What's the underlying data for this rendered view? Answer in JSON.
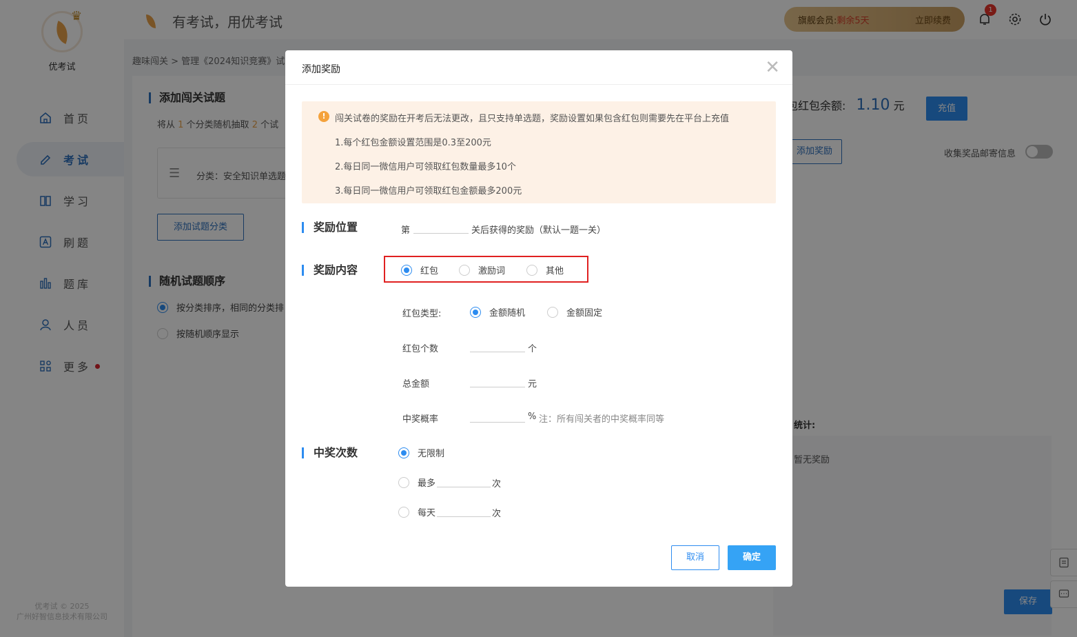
{
  "sidebar": {
    "logo_text": "优考试",
    "items": [
      {
        "label": "首页",
        "icon": "home-icon"
      },
      {
        "label": "考试",
        "icon": "pen-icon"
      },
      {
        "label": "学习",
        "icon": "book-icon"
      },
      {
        "label": "刷题",
        "icon": "letter-a-icon"
      },
      {
        "label": "题库",
        "icon": "bars-icon"
      },
      {
        "label": "人员",
        "icon": "user-icon"
      },
      {
        "label": "更多",
        "icon": "grid-icon"
      }
    ],
    "copyright_line1": "优考试 © 2025",
    "copyright_line2": "广州好智信息技术有限公司"
  },
  "header": {
    "slogan": "有考试，用优考试",
    "vip_label": "旗舰会员: ",
    "vip_days": "剩余5天",
    "vip_renew": "立即续费",
    "notification_count": "1"
  },
  "page": {
    "breadcrumb": "趣味闯关 > 管理《2024知识竞赛》试",
    "section1_title": "添加闯关试题",
    "section1_desc_pre": "将从 ",
    "section1_desc_n1": "1",
    "section1_desc_mid": " 个分类随机抽取 ",
    "section1_desc_n2": "2",
    "section1_desc_post": " 个试",
    "category_text": "分类：安全知识单选题",
    "add_category_button": "添加试题分类",
    "section2_title": "随机试题顺序",
    "order_option1": "按分类排序，相同的分类排",
    "order_option2": "按随机顺序显示",
    "balance_label": "包红包余额:",
    "balance_value": "1.10",
    "balance_unit": "元",
    "recharge_button": "充值",
    "add_reward_button": "添加奖励",
    "collect_label": "收集奖品邮寄信息",
    "stats_label": "统计:",
    "no_reward": "暂无奖励",
    "save_button": "保存"
  },
  "modal": {
    "title": "添加奖励",
    "notice": {
      "line1": "闯关试卷的奖励在开考后无法更改，且只支持单选题，奖励设置如果包含红包则需要先在平台上充值",
      "line2": "1.每个红包金额设置范围是0.3至200元",
      "line3": "2.每日同一微信用户可领取红包数量最多10个",
      "line4": "3.每日同一微信用户可领取红包金额最多200元"
    },
    "position": {
      "title": "奖励位置",
      "prefix": "第",
      "suffix": "关后获得的奖励（默认一题一关）",
      "value": ""
    },
    "content": {
      "title": "奖励内容",
      "options": [
        "红包",
        "激励词",
        "其他"
      ],
      "selected": "红包"
    },
    "redpacket": {
      "type_label": "红包类型:",
      "type_options": [
        "金额随机",
        "金额固定"
      ],
      "type_selected": "金额随机",
      "count_label": "红包个数",
      "count_unit": "个",
      "total_label": "总金额",
      "total_unit": "元",
      "prob_label": "中奖概率",
      "prob_unit": "%",
      "prob_note": "注：所有闯关者的中奖概率同等"
    },
    "times": {
      "title": "中奖次数",
      "opt_unlimited": "无限制",
      "opt_max": "最多",
      "opt_daily": "每天",
      "unit": "次",
      "selected": "无限制"
    },
    "cancel_button": "取消",
    "confirm_button": "确定"
  }
}
